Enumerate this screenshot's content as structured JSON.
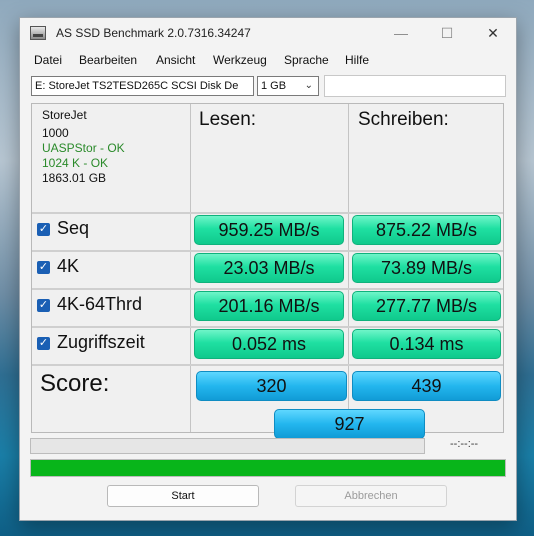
{
  "window": {
    "title": "AS SSD Benchmark 2.0.7316.34247",
    "min_glyph": "—",
    "max_glyph": "☐",
    "close_glyph": "✕"
  },
  "menu": [
    "Datei",
    "Bearbeiten",
    "Ansicht",
    "Werkzeug",
    "Sprache",
    "Hilfe"
  ],
  "toolbar": {
    "drive": "E: StoreJet TS2TESD265C SCSI Disk De",
    "size": "1 GB",
    "text": ""
  },
  "drive_info": {
    "name": "StoreJet",
    "firmware": "1000",
    "driver": "UASPStor - OK",
    "alignment": "1024 K - OK",
    "capacity": "1863.01 GB"
  },
  "headers": {
    "read": "Lesen:",
    "write": "Schreiben:"
  },
  "rows": [
    {
      "label": "Seq",
      "read": "959.25 MB/s",
      "write": "875.22 MB/s"
    },
    {
      "label": "4K",
      "read": "23.03 MB/s",
      "write": "73.89 MB/s"
    },
    {
      "label": "4K-64Thrd",
      "read": "201.16 MB/s",
      "write": "277.77 MB/s"
    },
    {
      "label": "Zugriffszeit",
      "read": "0.052 ms",
      "write": "0.134 ms"
    }
  ],
  "score": {
    "label": "Score:",
    "read": "320",
    "write": "439",
    "total": "927"
  },
  "progress": {
    "time": "--:--:--",
    "fraction": 1.0
  },
  "buttons": {
    "start": "Start",
    "abort": "Abbrechen"
  },
  "colors": {
    "result_green": "#1fe0a2",
    "score_blue": "#23b6ee",
    "progress_green": "#08b51a",
    "ok_text": "#2a8a2a",
    "checkbox_blue": "#1a5fb4"
  }
}
